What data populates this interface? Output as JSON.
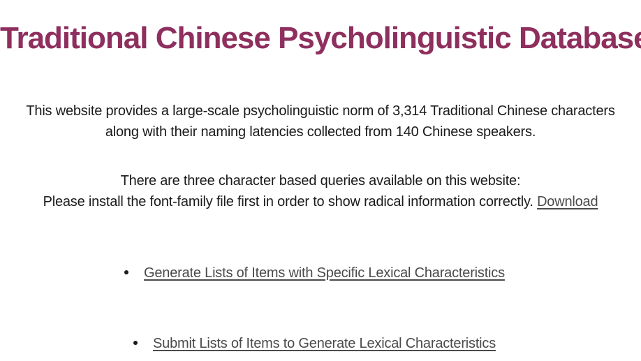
{
  "header": {
    "title": "Traditional Chinese Psycholinguistic Database"
  },
  "intro": {
    "line1": "This website provides a large-scale psycholinguistic norm of 3,314 Traditional Chinese characters",
    "line2": "along with their naming latencies collected from 140 Chinese speakers."
  },
  "queries": {
    "line1": "There are three character based queries available on this website:",
    "line2": "Please install the font-family file first in order to show radical information correctly.",
    "download_label": "Download"
  },
  "links": [
    {
      "label": "Generate Lists of Items with Specific Lexical Characteristics"
    },
    {
      "label": "Submit Lists of Items to Generate Lexical Characteristics"
    }
  ]
}
